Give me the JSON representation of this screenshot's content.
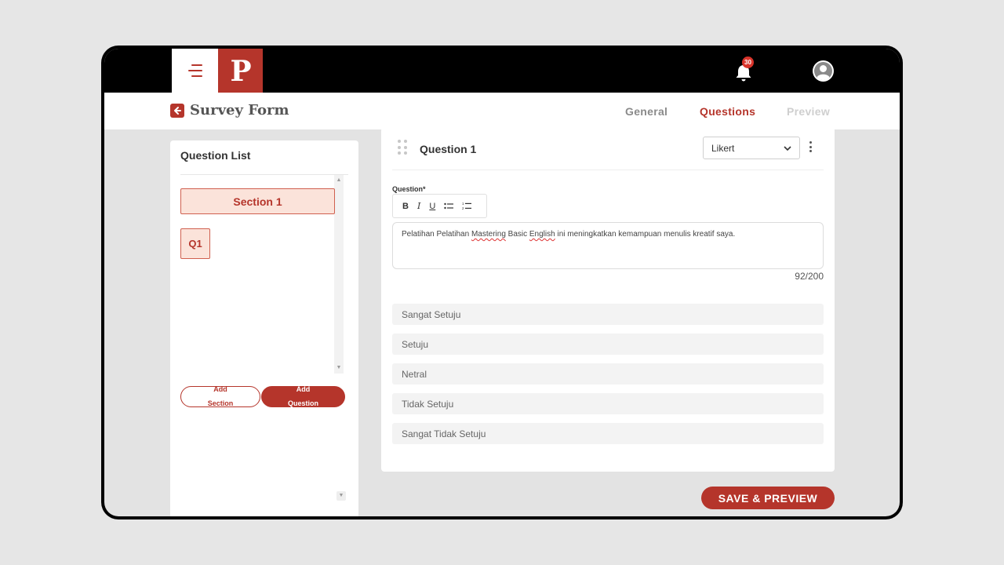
{
  "app": {
    "logo_letter": "P",
    "notification_count": "30"
  },
  "header": {
    "title": "Survey Form",
    "tabs": [
      {
        "label": "General",
        "state": "inactive"
      },
      {
        "label": "Questions",
        "state": "active"
      },
      {
        "label": "Preview",
        "state": "disabled"
      }
    ]
  },
  "sidebar": {
    "title": "Question List",
    "section_label": "Section 1",
    "question_chip": "Q1",
    "add_section_label": "Add Section",
    "add_question_label": "Add Question"
  },
  "editor": {
    "question_title": "Question 1",
    "type_value": "Likert",
    "field_label": "Question*",
    "toolbar": [
      "B",
      "I",
      "U",
      "bullet-list-icon",
      "numbered-list-icon"
    ],
    "question_text_parts": [
      {
        "text": "Pelatihan Pelatihan ",
        "spell": false
      },
      {
        "text": "Mastering",
        "spell": true
      },
      {
        "text": " Basic ",
        "spell": false
      },
      {
        "text": "English",
        "spell": true
      },
      {
        "text": " ini meningkatkan kemampuan menulis kreatif saya.",
        "spell": false
      }
    ],
    "char_count": "92/200",
    "options": [
      "Sangat Setuju",
      "Setuju",
      "Netral",
      "Tidak Setuju",
      "Sangat Tidak Setuju"
    ]
  },
  "actions": {
    "save_preview_label": "SAVE & PREVIEW"
  },
  "colors": {
    "brand": "#b5352b",
    "brand_light": "#fbe3da",
    "badge": "#d9342b"
  }
}
